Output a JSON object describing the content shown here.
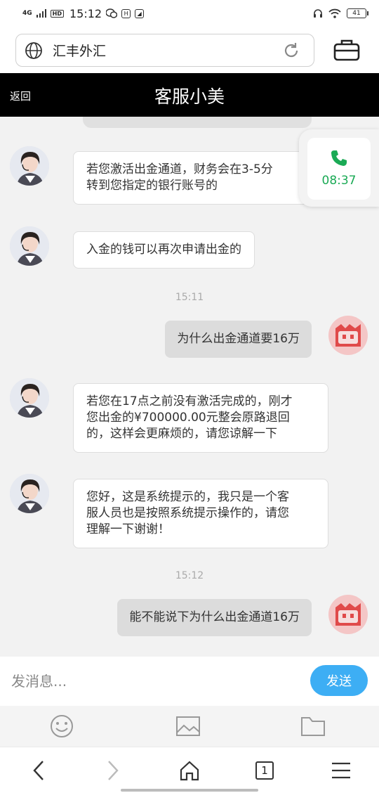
{
  "status_bar": {
    "time": "15:12",
    "network": "4G",
    "hd": "HD",
    "battery": "41"
  },
  "browser": {
    "url_text": "汇丰外汇"
  },
  "chat": {
    "back_label": "返回",
    "title": "客服小美"
  },
  "messages": [
    {
      "from": "cs",
      "text_lines": [
        "若您激活出金通道，财务会在3-5分",
        "转到您指定的银行账号的"
      ]
    },
    {
      "from": "cs",
      "text_lines": [
        "入金的钱可以再次申请出金的"
      ]
    },
    {
      "type": "time",
      "text": "15:11"
    },
    {
      "from": "me",
      "text_lines": [
        "为什么出金通道要16万"
      ]
    },
    {
      "from": "cs",
      "text_lines": [
        "若您在17点之前没有激活完成的，刚才",
        "您出金的¥700000.00元整会原路退回",
        "的，这样会更麻烦的，请您谅解一下"
      ]
    },
    {
      "from": "cs",
      "text_lines": [
        "您好，这是系统提示的，我只是一个客",
        "服人员也是按照系统提示操作的，请您",
        "理解一下谢谢！"
      ]
    },
    {
      "type": "time",
      "text": "15:12"
    },
    {
      "from": "me",
      "text_lines": [
        "能不能说下为什么出金通道16万"
      ]
    }
  ],
  "call": {
    "duration": "08:37",
    "color": "#1aaa55"
  },
  "input": {
    "placeholder": "发消息...",
    "send_label": "发送",
    "send_color": "#3daef4"
  },
  "toolbar": {
    "icons": [
      "emoji-icon",
      "image-icon",
      "folder-icon"
    ]
  },
  "nav": {
    "tab_count": "1",
    "icons": [
      "back-arrow-icon",
      "forward-arrow-icon",
      "home-icon",
      "tabs-icon",
      "menu-icon"
    ]
  }
}
